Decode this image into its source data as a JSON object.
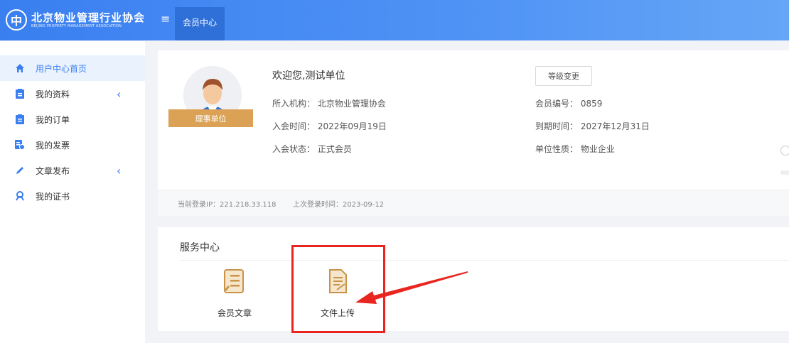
{
  "header": {
    "logo_cn": "北京物业管理行业协会",
    "logo_en": "BEIJING PROPERTY MANAGEMENT ASSOCIATION",
    "tab_label": "会员中心",
    "menu_icon": "hamburger-icon",
    "brand_color": "#3a7ff0"
  },
  "sidebar": {
    "items": [
      {
        "label": "用户中心首页",
        "icon": "home-icon",
        "active": true
      },
      {
        "label": "我的资料",
        "icon": "profile-icon",
        "has_submenu": true
      },
      {
        "label": "我的订单",
        "icon": "order-icon"
      },
      {
        "label": "我的发票",
        "icon": "invoice-icon"
      },
      {
        "label": "文章发布",
        "icon": "pen-icon",
        "has_submenu": true
      },
      {
        "label": "我的证书",
        "icon": "certificate-icon"
      }
    ]
  },
  "profile": {
    "badge": "理事单位",
    "welcome": "欢迎您,测试单位",
    "org_label": "所入机构：",
    "org_value": "北京物业管理协会",
    "join_time_label": "入会时间：",
    "join_time_value": "2022年09月19日",
    "join_status_label": "入会状态：",
    "join_status_value": "正式会员",
    "level_button": "等级变更",
    "member_no_label": "会员编号：",
    "member_no_value": "0859",
    "expire_label": "到期时间：",
    "expire_value": "2027年12月31日",
    "unit_type_label": "单位性质：",
    "unit_type_value": "物业企业",
    "login_ip": "当前登录IP：221.218.33.118",
    "last_login": "上次登录时间：2023-09-12"
  },
  "services": {
    "title": "服务中心",
    "items": [
      {
        "label": "会员文章",
        "icon": "article-icon"
      },
      {
        "label": "文件上传",
        "icon": "file-upload-icon"
      }
    ]
  },
  "annotation": {
    "highlight_color": "#e8261f"
  }
}
